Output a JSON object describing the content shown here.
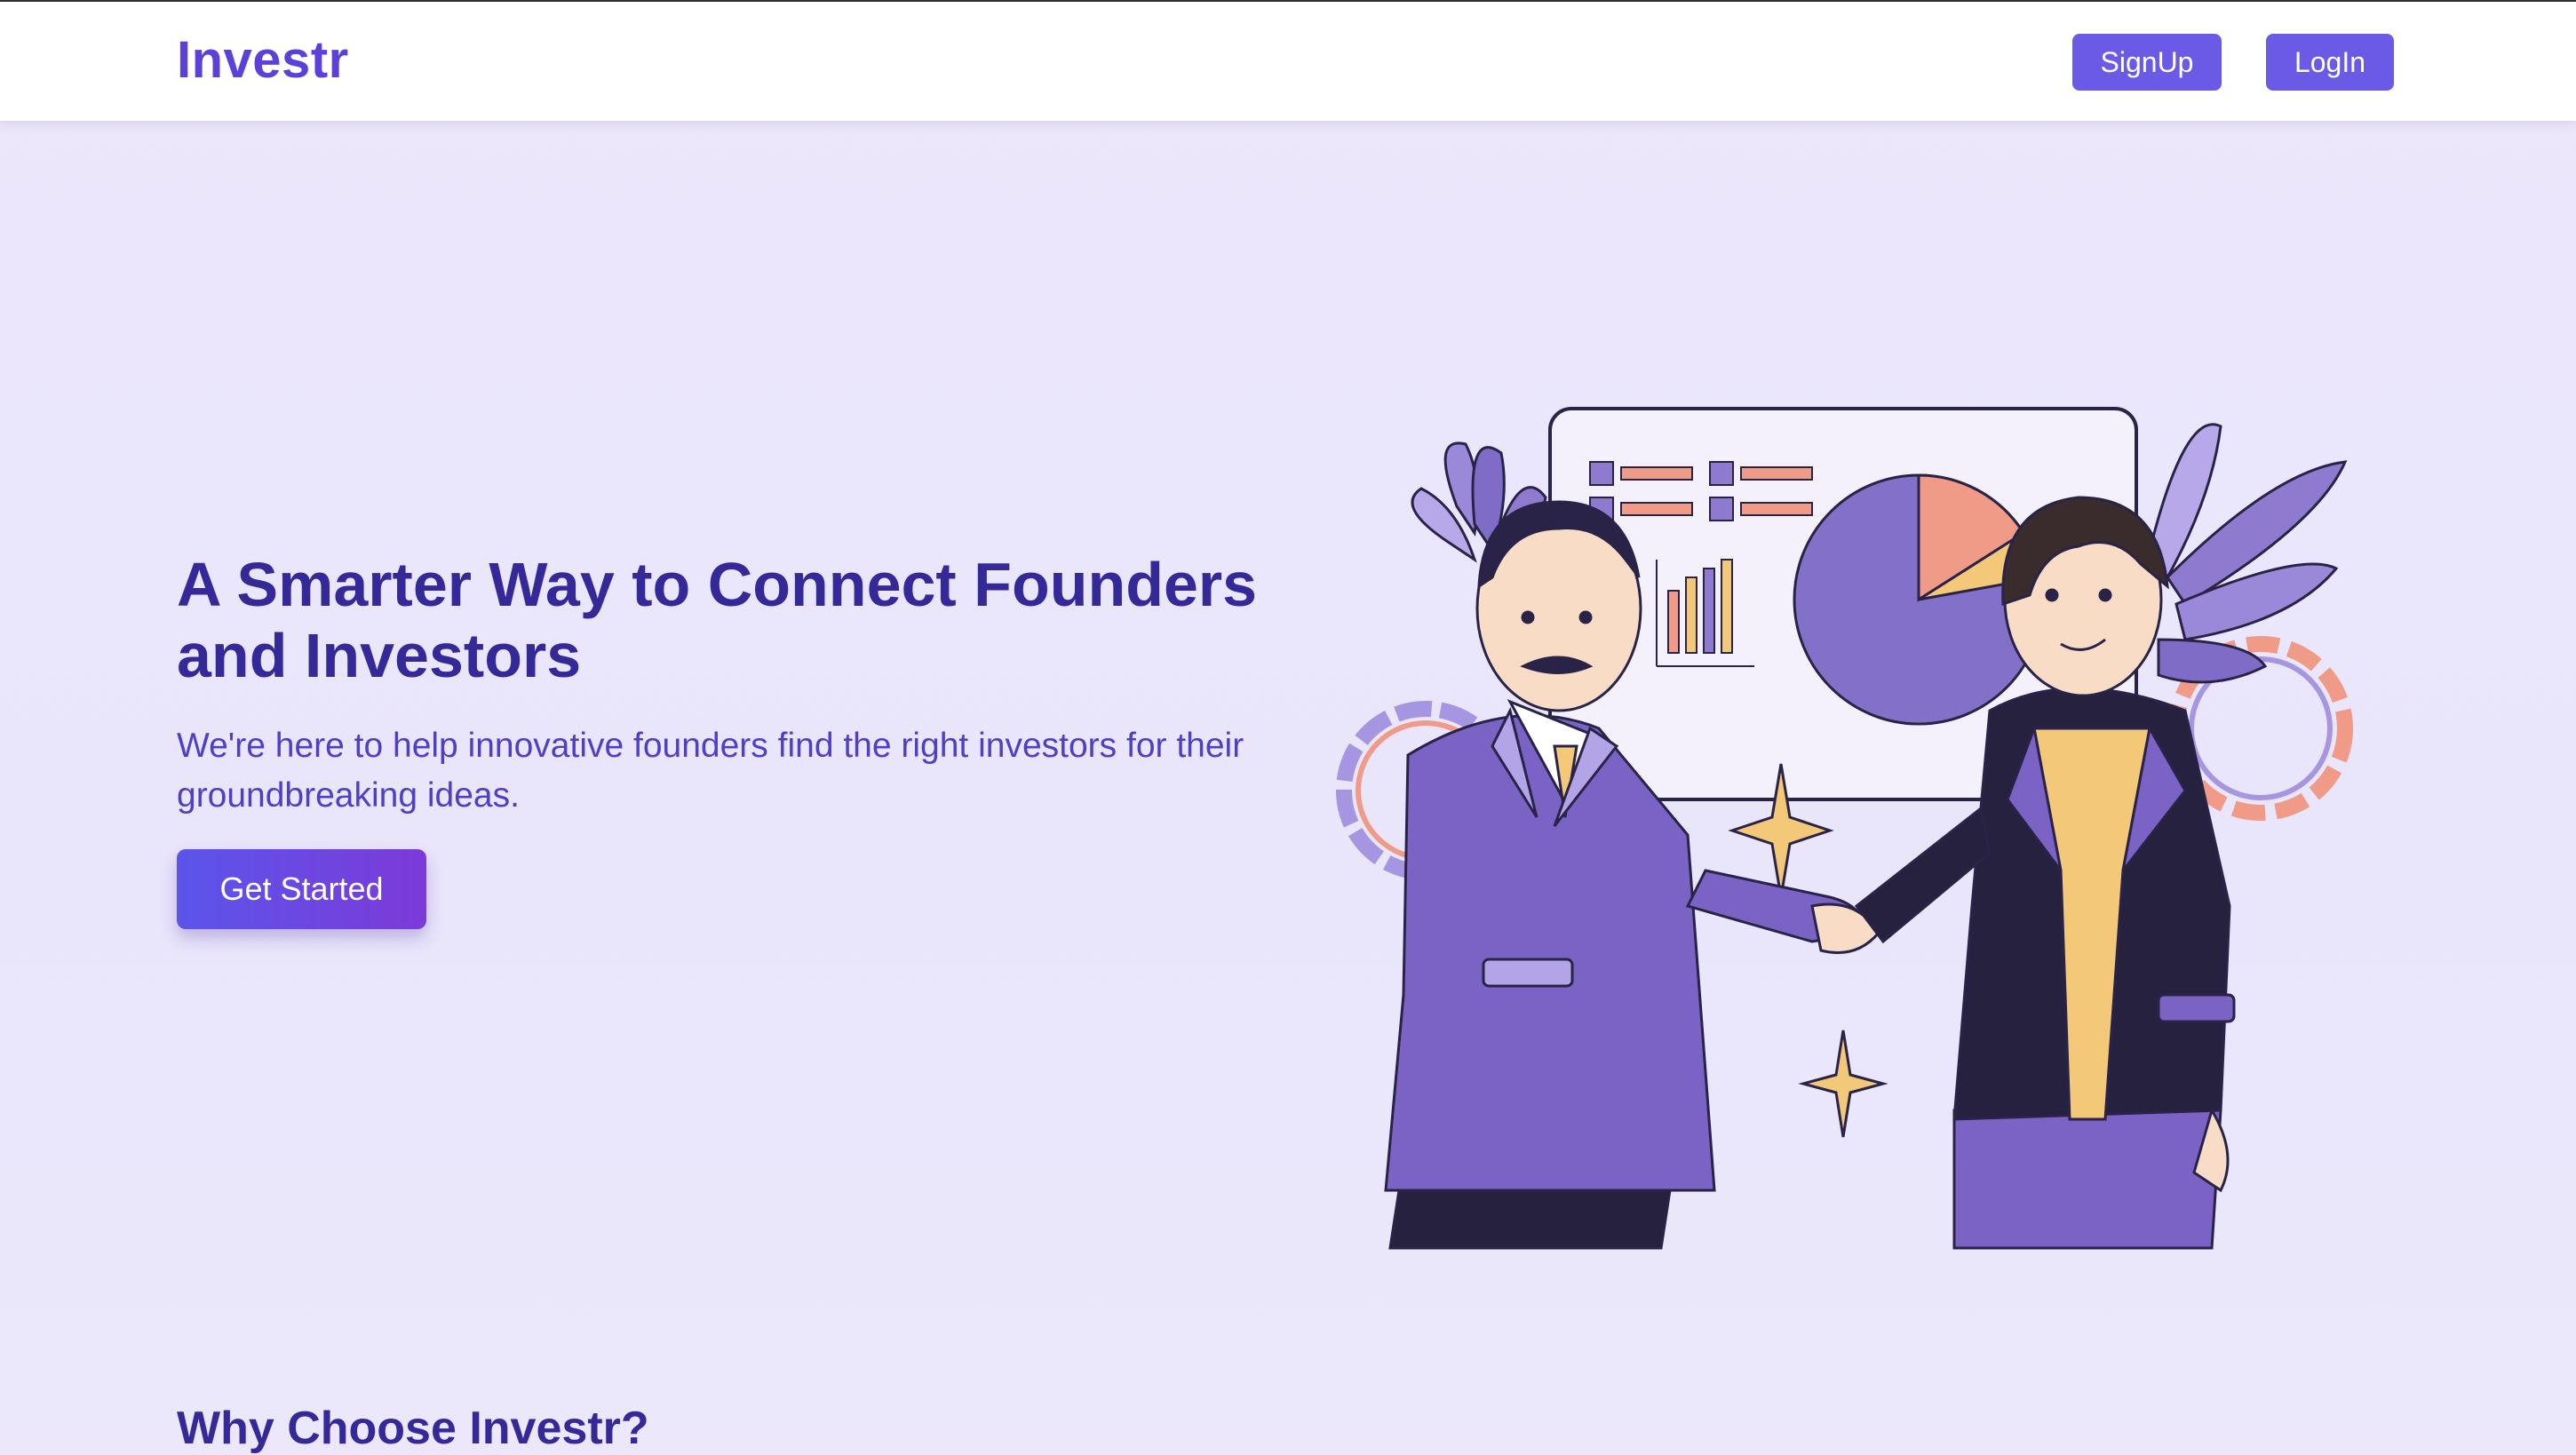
{
  "nav": {
    "brand": "Investr",
    "signup_label": "SignUp",
    "login_label": "LogIn"
  },
  "hero": {
    "title": "A Smarter Way to Connect Founders and Investors",
    "subtitle": "We're here to help innovative founders find the right investors for their groundbreaking ideas.",
    "cta_label": "Get Started",
    "illustration_icon": "handshake-illustration"
  },
  "features": {
    "heading": "Why Choose Investr?"
  },
  "colors": {
    "brand": "#5b41d9",
    "heading": "#35299a",
    "button": "#6a5ae6",
    "cta_start": "#5b55ea",
    "cta_end": "#7c3ad9",
    "background": "#ece7fb"
  }
}
